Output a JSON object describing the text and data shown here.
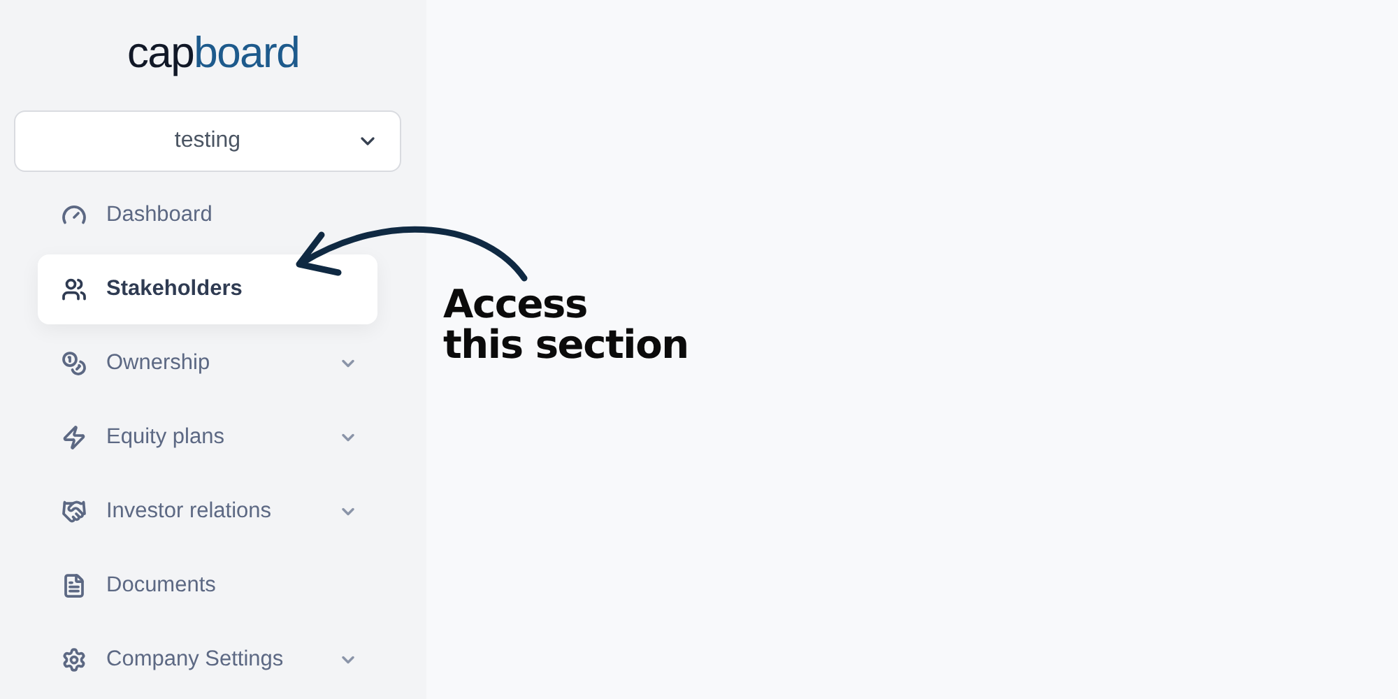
{
  "logo": {
    "dark": "cap",
    "accent": "board"
  },
  "company_select": {
    "value": "testing"
  },
  "nav": [
    {
      "label": "Dashboard",
      "selected": false,
      "expandable": false
    },
    {
      "label": "Stakeholders",
      "selected": true,
      "expandable": false
    },
    {
      "label": "Ownership",
      "selected": false,
      "expandable": true
    },
    {
      "label": "Equity plans",
      "selected": false,
      "expandable": true
    },
    {
      "label": "Investor relations",
      "selected": false,
      "expandable": true
    },
    {
      "label": "Documents",
      "selected": false,
      "expandable": false
    },
    {
      "label": "Company Settings",
      "selected": false,
      "expandable": true
    }
  ],
  "annotation": {
    "lines": [
      "Access",
      "this section"
    ]
  }
}
